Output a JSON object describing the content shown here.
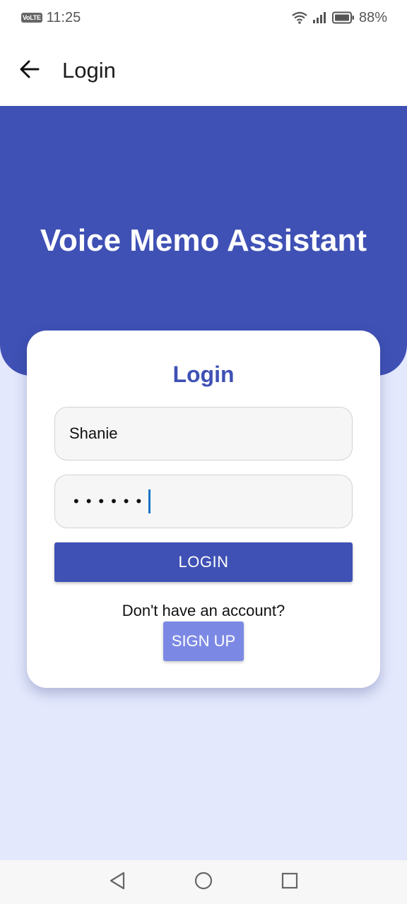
{
  "status_bar": {
    "network_badge": "VoLTE",
    "time": "11:25",
    "battery": "88%",
    "icons": [
      "wifi-icon",
      "signal-icon",
      "battery-icon"
    ]
  },
  "app_bar": {
    "title": "Login",
    "back_icon": "arrow-left-icon"
  },
  "hero": {
    "title": "Voice Memo Assistant"
  },
  "card": {
    "title": "Login",
    "username_value": "Shanie",
    "password_mask": "••••••",
    "login_label": "LOGIN",
    "no_account_text": "Don't have an account?",
    "signup_label": "SIGN UP"
  },
  "nav_bar": {
    "icons": [
      "back-triangle-icon",
      "home-circle-icon",
      "recents-square-icon"
    ]
  },
  "colors": {
    "primary": "#3f51b5",
    "background": "#e3e8fd",
    "signup_button": "#7c89e4",
    "cursor": "#1a73c8"
  }
}
